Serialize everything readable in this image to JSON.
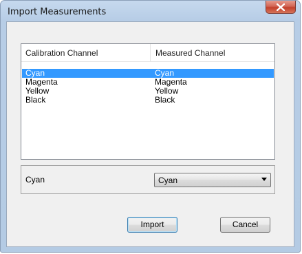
{
  "window": {
    "title": "Import Measurements",
    "close_icon": "close-icon"
  },
  "list": {
    "columns": [
      "Calibration Channel",
      "Measured Channel"
    ],
    "rows": [
      {
        "calibration": "Cyan",
        "measured": "Cyan",
        "selected": true
      },
      {
        "calibration": "Magenta",
        "measured": "Magenta",
        "selected": false
      },
      {
        "calibration": "Yellow",
        "measured": "Yellow",
        "selected": false
      },
      {
        "calibration": "Black",
        "measured": "Black",
        "selected": false
      }
    ]
  },
  "mapping": {
    "channel_label": "Cyan",
    "measured_select_value": "Cyan"
  },
  "buttons": {
    "import_label": "Import",
    "cancel_label": "Cancel"
  },
  "colors": {
    "selection": "#3399ff",
    "close_button": "#c2402b"
  }
}
